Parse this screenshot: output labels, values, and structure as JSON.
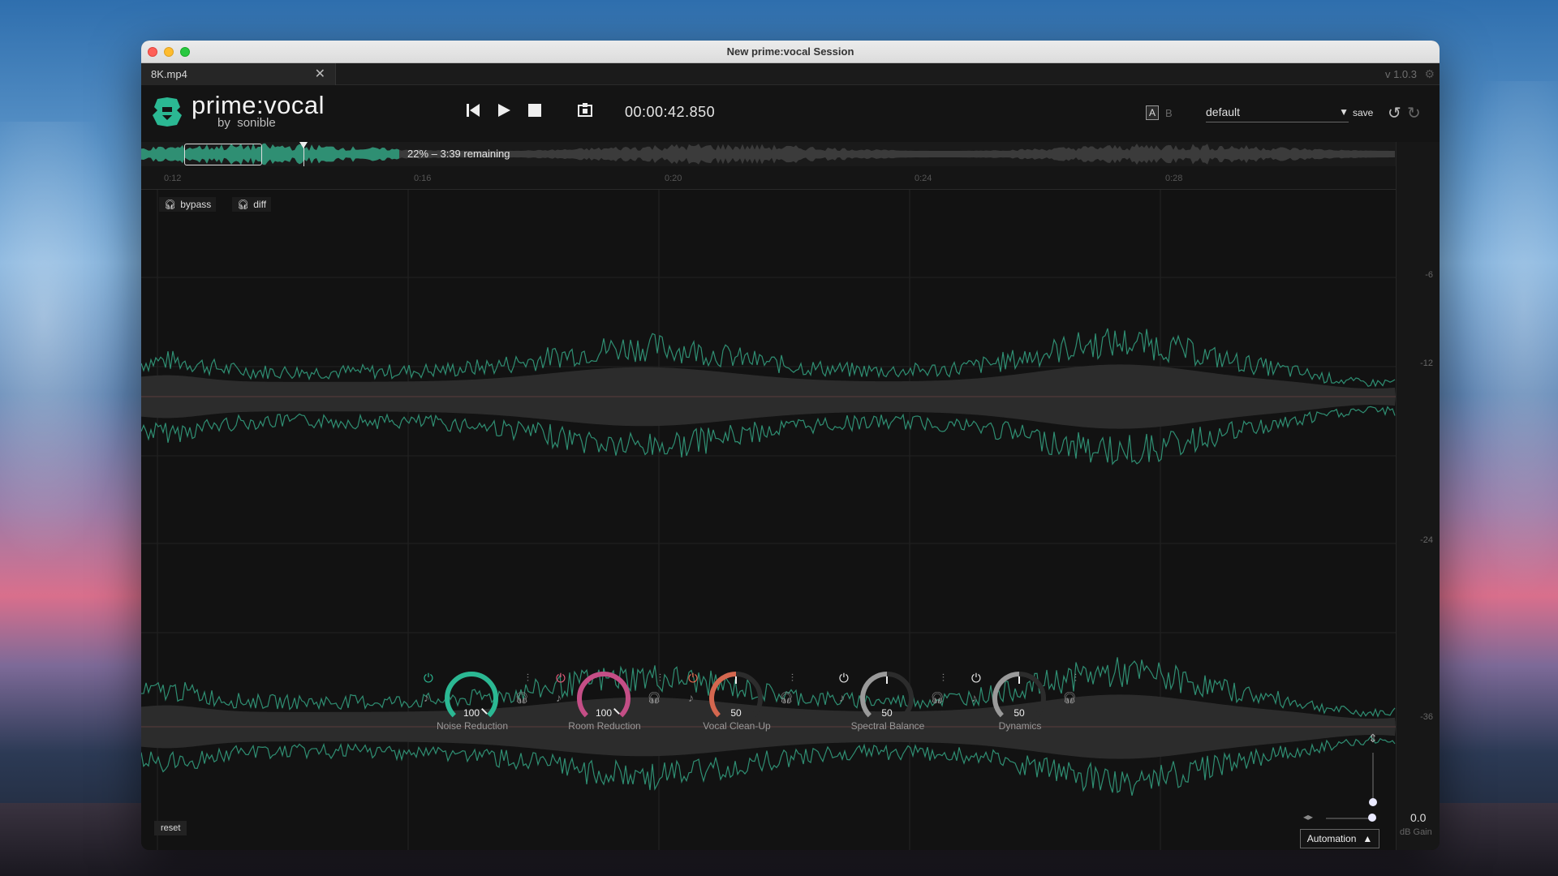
{
  "window": {
    "title": "New prime:vocal Session"
  },
  "tab": {
    "label": "8K.mp4"
  },
  "version": "v 1.0.3",
  "logo": {
    "name": "prime:vocal",
    "by": "by",
    "maker": "sonible"
  },
  "transport": {
    "timecode": "00:00:42.850"
  },
  "ab": {
    "a": "A",
    "b": "B"
  },
  "preset": {
    "value": "default",
    "save": "save"
  },
  "overview": {
    "progress_text": "22% – 3:39 remaining",
    "progress_fraction": 0.22
  },
  "ruler": {
    "ticks": [
      "0:12",
      "0:16",
      "0:20",
      "0:24",
      "0:28"
    ]
  },
  "listen": {
    "bypass": "bypass",
    "diff": "diff"
  },
  "db_scale": [
    "-6",
    "-12",
    "-24",
    "-36"
  ],
  "modules": [
    {
      "name": "Noise Reduction",
      "value": "100",
      "color": "#2bb893",
      "power_color": "#2bb893"
    },
    {
      "name": "Room Reduction",
      "value": "100",
      "color": "#c44e86",
      "power_color": "#ea5a7c"
    },
    {
      "name": "Vocal Clean-Up",
      "value": "50",
      "color": "#d4674f",
      "power_color": "#ef6a50"
    },
    {
      "name": "Spectral Balance",
      "value": "50",
      "color": "#9a9a9a",
      "power_color": "#e6e6e6"
    },
    {
      "name": "Dynamics",
      "value": "50",
      "color": "#9a9a9a",
      "power_color": "#e6e6e6"
    }
  ],
  "footer": {
    "reset": "reset",
    "automation": "Automation",
    "gain_value": "0.0",
    "gain_label": "dB Gain"
  },
  "colors": {
    "accent": "#2bb893",
    "wave_green": "#2f8f73",
    "wave_gray": "#4a4a4a"
  }
}
